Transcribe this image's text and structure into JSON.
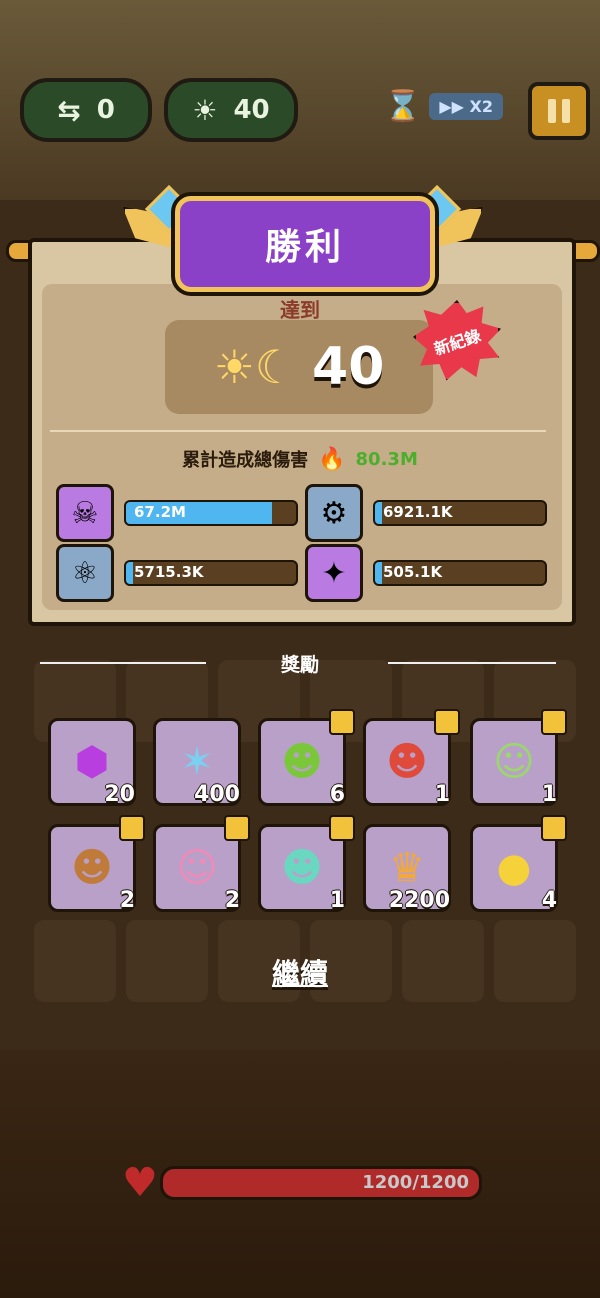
{
  "hud": {
    "moves_icon": "swap-arrows-icon",
    "moves_value": "0",
    "wave_icon": "sun-moon-icon",
    "wave_value": "40",
    "speed_icon": "hourglass-icon",
    "speed_label": "X2",
    "pause_icon": "pause-icon"
  },
  "result": {
    "title": "勝利",
    "reached_label": "達到",
    "wave_value": "40",
    "new_record_label": "新紀錄",
    "damage_label": "累計造成總傷害",
    "damage_total": "80.3M",
    "damage_rows": [
      {
        "icon": "demon-mask-icon",
        "value": "67.2M",
        "fill": 0.86,
        "color": "#b97ae2"
      },
      {
        "icon": "armored-beetle-icon",
        "value": "6921.1K",
        "fill": 0.04,
        "color": "#8aa9c8"
      },
      {
        "icon": "purple-robot-icon",
        "value": "5715.3K",
        "fill": 0.03,
        "color": "#8aa9c8"
      },
      {
        "icon": "blue-flame-mage-icon",
        "value": "505.1K",
        "fill": 0.01,
        "color": "#b97ae2"
      }
    ]
  },
  "rewards": {
    "title": "獎勵",
    "items": [
      {
        "icon": "purple-gem-icon",
        "qty": "20",
        "puzzle": false
      },
      {
        "icon": "blue-crystal-icon",
        "qty": "400",
        "puzzle": false
      },
      {
        "icon": "green-goblin-icon",
        "qty": "6",
        "puzzle": true
      },
      {
        "icon": "red-ox-demon-icon",
        "qty": "1",
        "puzzle": true
      },
      {
        "icon": "green-hair-girl-icon",
        "qty": "1",
        "puzzle": true
      },
      {
        "icon": "monkey-icon",
        "qty": "2",
        "puzzle": true
      },
      {
        "icon": "pink-cat-girl-icon",
        "qty": "2",
        "puzzle": true
      },
      {
        "icon": "teal-fish-monster-icon",
        "qty": "1",
        "puzzle": true
      },
      {
        "icon": "gold-crown-coin-icon",
        "qty": "2200",
        "puzzle": false
      },
      {
        "icon": "yellow-chick-icon",
        "qty": "4",
        "puzzle": true
      }
    ]
  },
  "continue_label": "繼續",
  "player": {
    "hp_text": "1200/1200",
    "hp_fraction": 1.0
  }
}
